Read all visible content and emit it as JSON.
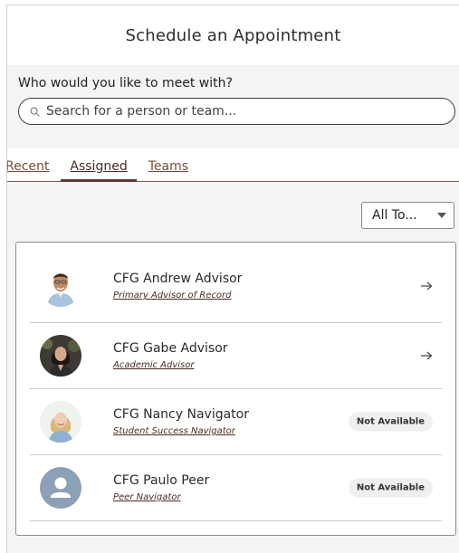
{
  "header": {
    "title": "Schedule an Appointment"
  },
  "search": {
    "question": "Who would you like to meet with?",
    "placeholder": "Search for a person or team...",
    "value": ""
  },
  "tabs": [
    {
      "label": "Recent",
      "active": false
    },
    {
      "label": "Assigned",
      "active": true
    },
    {
      "label": "Teams",
      "active": false
    }
  ],
  "filter": {
    "label": "All To..."
  },
  "people": [
    {
      "name": "CFG Andrew Advisor",
      "role": "Primary Advisor of Record",
      "action": "arrow",
      "avatar": "man-in-shirt-avatar"
    },
    {
      "name": "CFG Gabe Advisor",
      "role": "Academic Advisor",
      "action": "arrow",
      "avatar": "woman-dark-hair-avatar"
    },
    {
      "name": "CFG Nancy Navigator",
      "role": "Student Success Navigator",
      "action": "badge",
      "status": "Not Available",
      "avatar": "woman-blonde-avatar"
    },
    {
      "name": "CFG Paulo Peer",
      "role": "Peer Navigator",
      "action": "badge",
      "status": "Not Available",
      "avatar": "generic-person-avatar"
    }
  ],
  "colors": {
    "accent": "#5a3a32",
    "link": "#7a4b3a",
    "panel": "#f4f4f4"
  }
}
